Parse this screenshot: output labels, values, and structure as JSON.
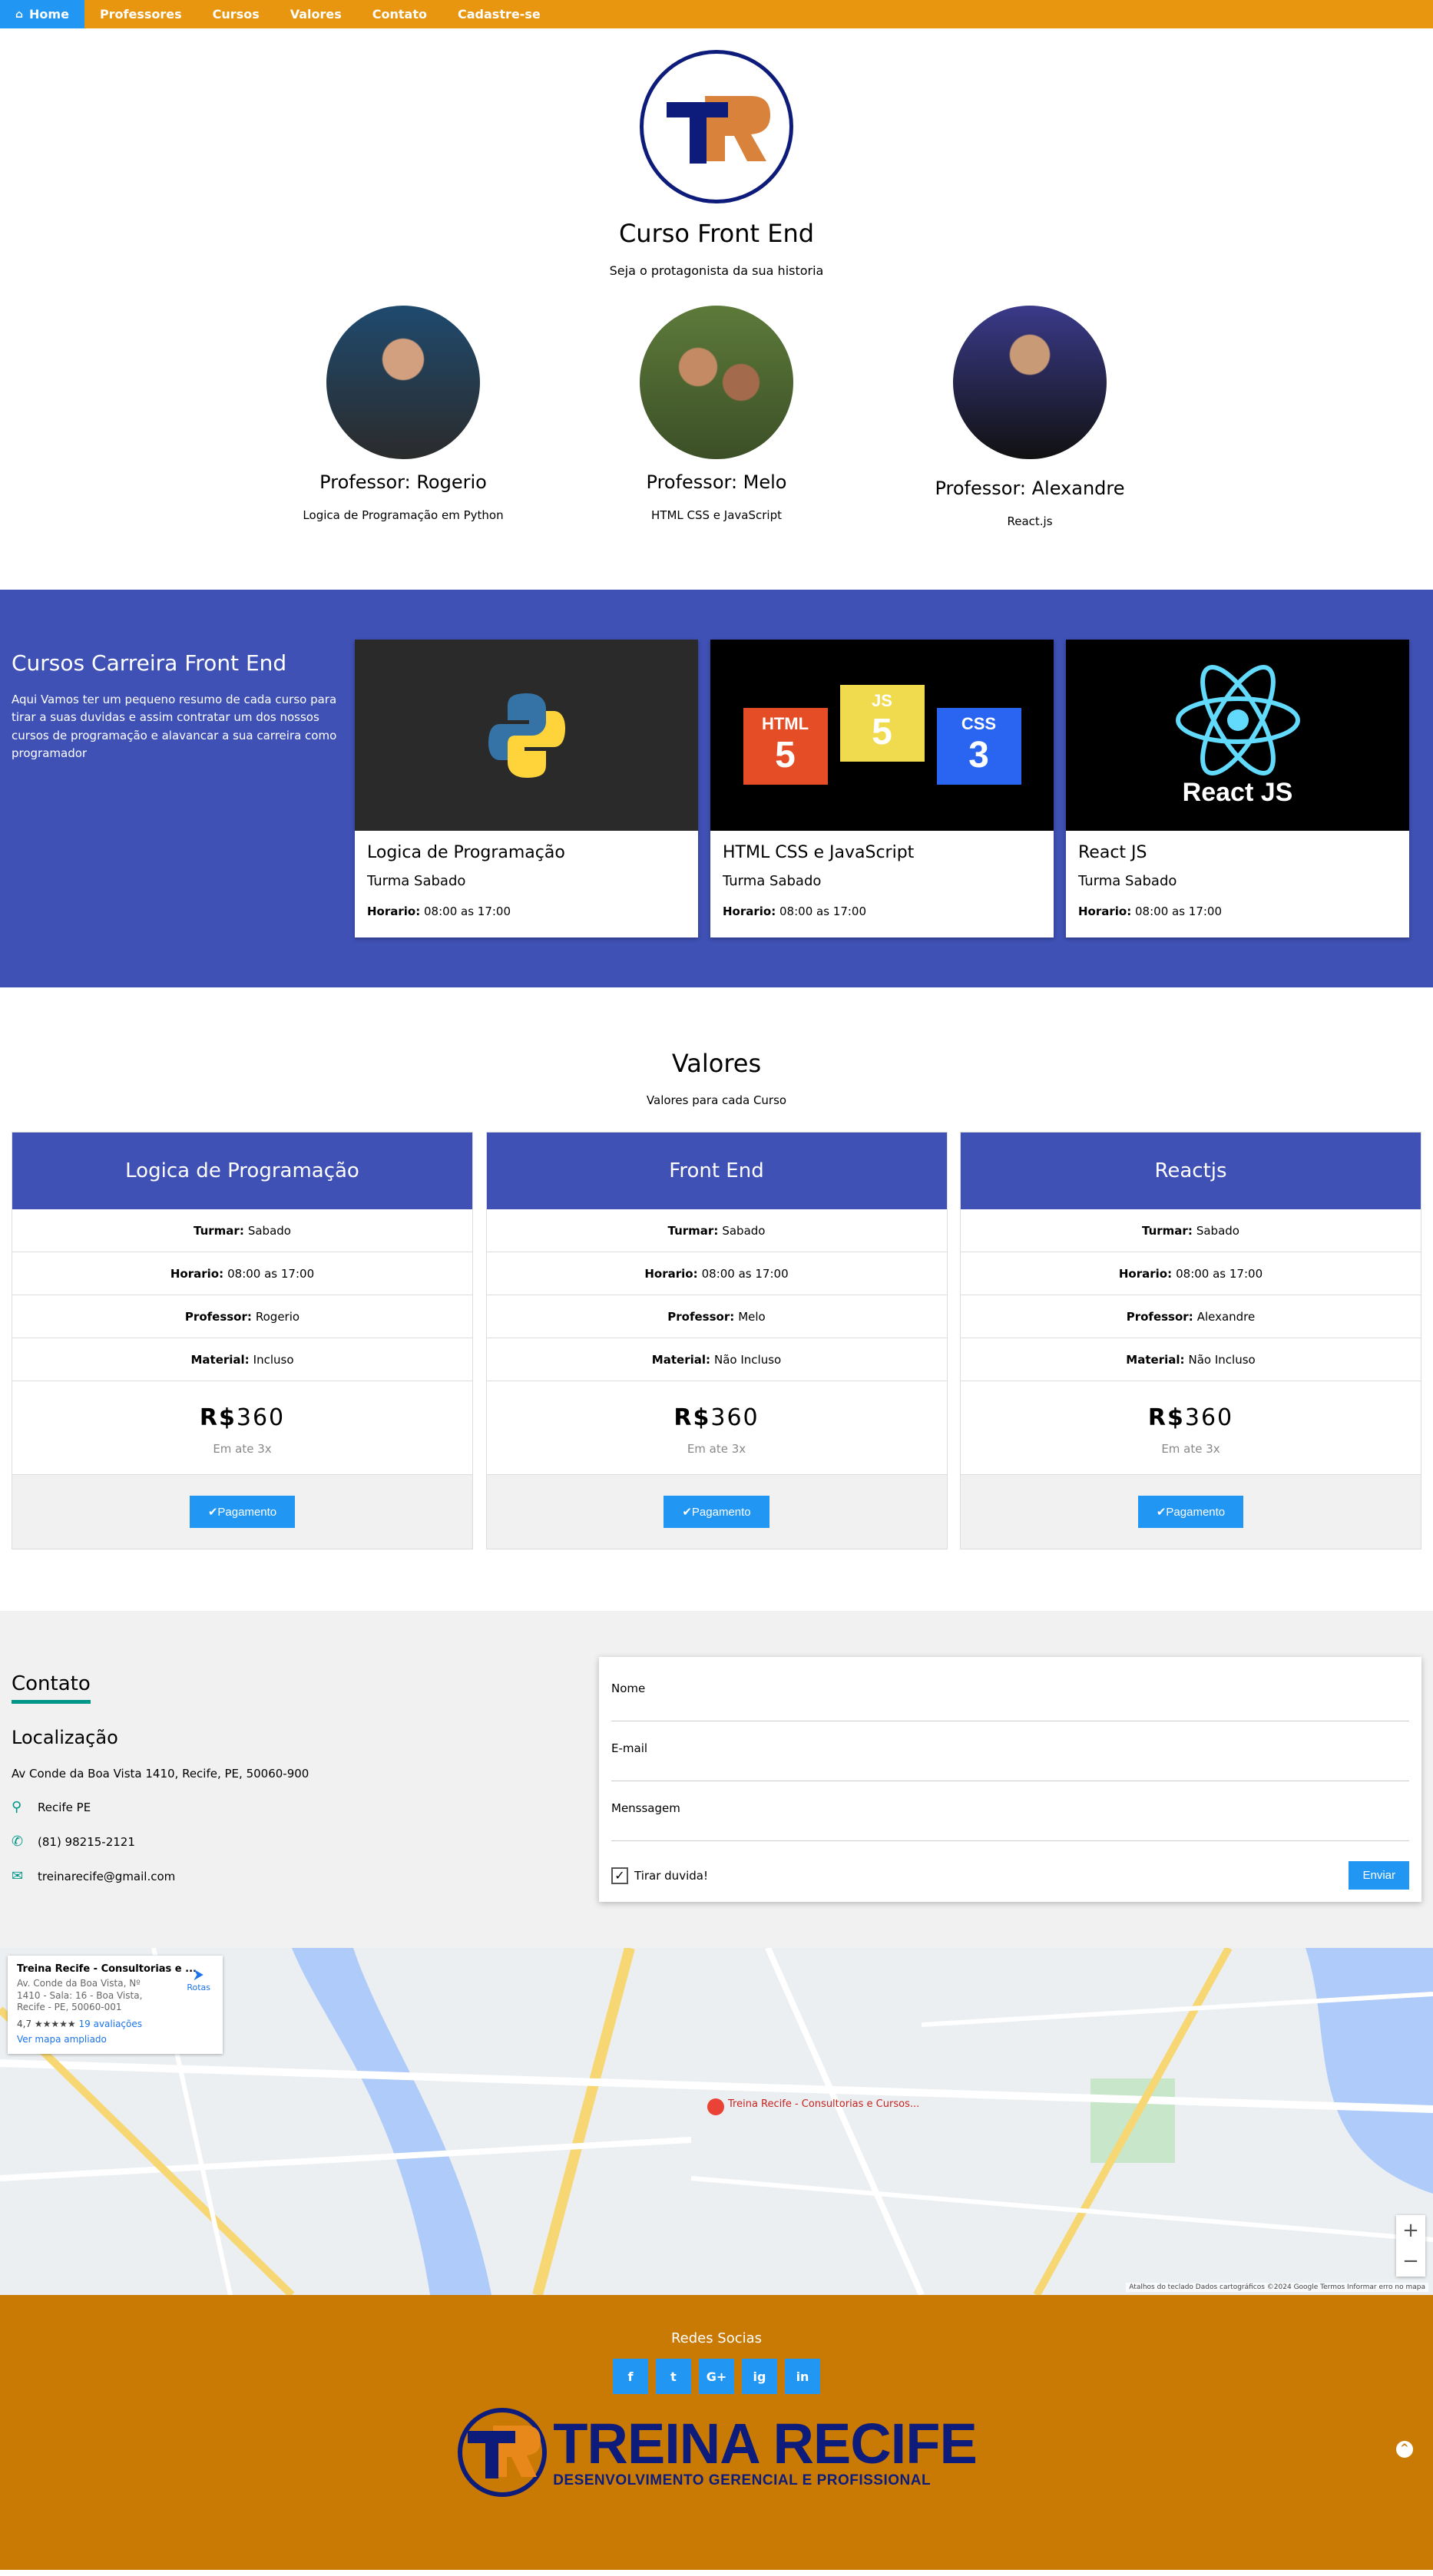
{
  "nav": {
    "home": "Home",
    "items": [
      "Professores",
      "Cursos",
      "Valores",
      "Contato",
      "Cadastre-se"
    ]
  },
  "hero": {
    "title": "Curso Front End",
    "subtitle": "Seja o protagonista da sua historia"
  },
  "professors": [
    {
      "name": "Professor: Rogerio",
      "desc": "Logica de Programação em Python"
    },
    {
      "name": "Professor: Melo",
      "desc": "HTML CSS e JavaScript"
    },
    {
      "name": "Professor: Alexandre",
      "desc": "React.js"
    }
  ],
  "career": {
    "title": "Cursos Carreira Front End",
    "text": "Aqui Vamos ter um pequeno resumo de cada curso para tirar a suas duvidas e assim contratar um dos nossos cursos de programação e alavancar a sua carreira como programador",
    "cards": [
      {
        "title": "Logica de Programação",
        "turma": "Turma Sabado",
        "hour_label": "Horario:",
        "hour": "08:00 as 17:00"
      },
      {
        "title": "HTML CSS e JavaScript",
        "turma": "Turma Sabado",
        "hour_label": "Horario:",
        "hour": "08:00 as 17:00"
      },
      {
        "title": "React JS",
        "turma": "Turma Sabado",
        "hour_label": "Horario:",
        "hour": "08:00 as 17:00"
      }
    ],
    "images": {
      "html": "HTML",
      "js": "JS",
      "css": "CSS",
      "react": "React JS"
    }
  },
  "valores": {
    "title": "Valores",
    "subtitle": "Valores para cada Curso",
    "labels": {
      "turma": "Turmar:",
      "horario": "Horario:",
      "professor": "Professor:",
      "material": "Material:"
    },
    "currency": "R$",
    "plans": [
      {
        "name": "Logica de Programação",
        "turma": "Sabado",
        "horario": "08:00 as 17:00",
        "professor": "Rogerio",
        "material": "Incluso",
        "price": "360",
        "note": "Em ate 3x",
        "button": "✔Pagamento"
      },
      {
        "name": "Front End",
        "turma": "Sabado",
        "horario": "08:00 as 17:00",
        "professor": "Melo",
        "material": "Não Incluso",
        "price": "360",
        "note": "Em ate 3x",
        "button": "✔Pagamento"
      },
      {
        "name": "Reactjs",
        "turma": "Sabado",
        "horario": "08:00 as 17:00",
        "professor": "Alexandre",
        "material": "Não Incluso",
        "price": "360",
        "note": "Em ate 3x",
        "button": "✔Pagamento"
      }
    ]
  },
  "contact": {
    "title": "Contato",
    "loc_title": "Localização",
    "address": "Av Conde da Boa Vista 1410, Recife, PE, 50060-900",
    "city": "Recife PE",
    "phone": "(81) 98215-2121",
    "email": "treinarecife@gmail.com",
    "form": {
      "name_label": "Nome",
      "email_label": "E-mail",
      "message_label": "Menssagem",
      "checkbox": "Tirar duvida!",
      "submit": "Enviar"
    }
  },
  "map": {
    "place_title": "Treina Recife - Consultorias e ...",
    "place_address": "Av. Conde da Boa Vista, Nº 1410 - Sala: 16 - Boa Vista, Recife - PE, 50060-001",
    "rating": "4,7 ★★★★★",
    "reviews": "19 avaliações",
    "larger_map": "Ver mapa ampliado",
    "directions": "Rotas",
    "pin_label": "Treina Recife - Consultorias e Cursos...",
    "attribution": "Atalhos do teclado   Dados cartográficos ©2024 Google   Termos   Informar erro no mapa"
  },
  "footer": {
    "title": "Redes Socias",
    "socials": [
      "f",
      "t",
      "G+",
      "ig",
      "in"
    ],
    "brand_name": "TREINA RECIFE",
    "brand_tag": "DESENVOLVIMENTO GERENCIAL E PROFISSIONAL"
  },
  "colors": {
    "nav": "#e8960f",
    "accent": "#2196F3",
    "indigo": "#3f51b5",
    "footer": "#c97a04",
    "teal": "#009688",
    "brand_navy": "#0d1c7a"
  }
}
